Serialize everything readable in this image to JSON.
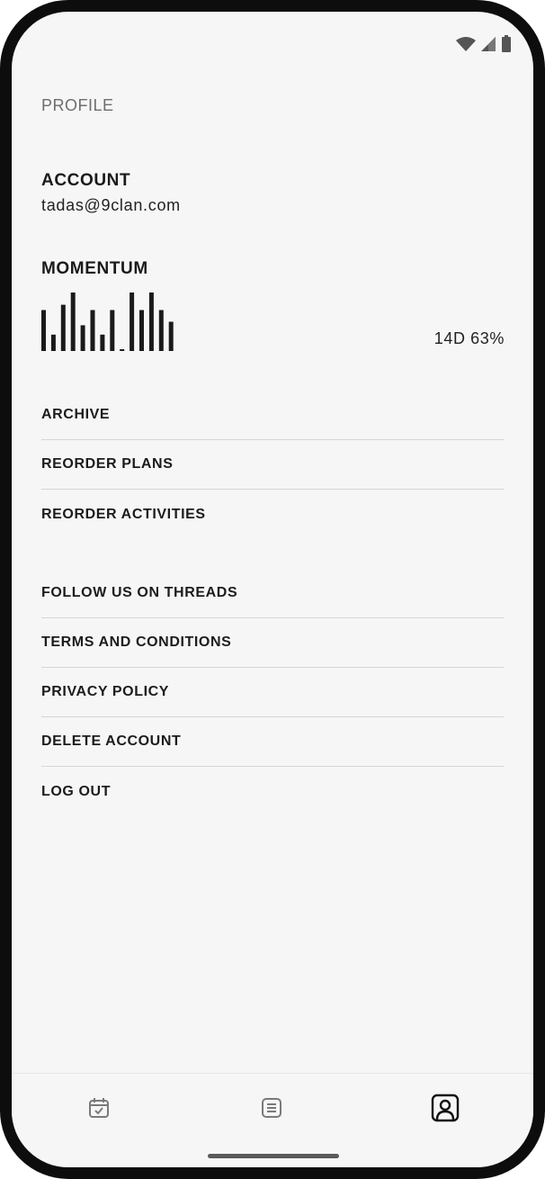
{
  "status_bar": {
    "icons": [
      "wifi-icon",
      "cell-signal-icon",
      "battery-icon"
    ]
  },
  "header": {
    "title": "PROFILE"
  },
  "account": {
    "heading": "ACCOUNT",
    "email": "tadas@9clan.com"
  },
  "momentum": {
    "heading": "MOMENTUM",
    "stat": "14D 63%",
    "bar_levels": [
      0.7,
      0.28,
      0.79,
      1.0,
      0.44,
      0.7,
      0.28,
      0.7,
      0.02,
      1.0,
      0.7,
      1.0,
      0.7,
      0.5
    ]
  },
  "menu_primary": [
    {
      "label": "ARCHIVE"
    },
    {
      "label": "REORDER PLANS"
    },
    {
      "label": "REORDER ACTIVITIES"
    }
  ],
  "menu_secondary": [
    {
      "label": "FOLLOW US ON THREADS"
    },
    {
      "label": "TERMS AND CONDITIONS"
    },
    {
      "label": "PRIVACY POLICY"
    },
    {
      "label": "DELETE ACCOUNT"
    },
    {
      "label": "LOG OUT"
    }
  ],
  "bottom_nav": {
    "items": [
      {
        "icon": "calendar-check-icon",
        "active": false
      },
      {
        "icon": "list-icon",
        "active": false
      },
      {
        "icon": "profile-icon",
        "active": true
      }
    ]
  },
  "colors": {
    "background": "#f6f6f6",
    "text_primary": "#1a1a1a",
    "text_muted": "#6d6d6d",
    "divider": "#d6d6d6",
    "bar": "#1a1a1a"
  }
}
